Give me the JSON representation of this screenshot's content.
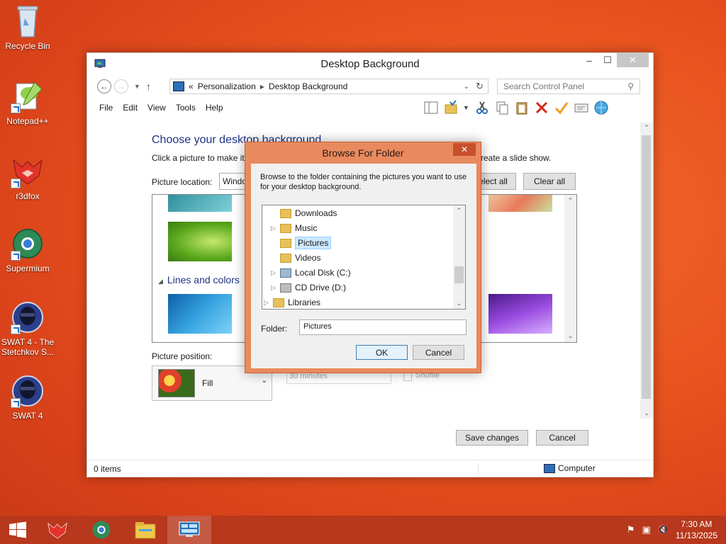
{
  "desktop": {
    "icons": [
      {
        "label": "Recycle Bin"
      },
      {
        "label": "Notepad++"
      },
      {
        "label": "r3dfox"
      },
      {
        "label": "Supermium"
      },
      {
        "label": "SWAT 4 - The Stetchkov S..."
      },
      {
        "label": "SWAT 4"
      }
    ]
  },
  "window": {
    "title": "Desktop Background",
    "breadcrumb": [
      "«",
      "Personalization",
      "Desktop Background"
    ],
    "search_placeholder": "Search Control Panel",
    "menu": [
      "File",
      "Edit",
      "View",
      "Tools",
      "Help"
    ],
    "heading": "Choose your desktop background",
    "subtext": "Click a picture to make it",
    "subtext_tail": "reate a slide show.",
    "picture_location_label": "Picture location:",
    "picture_location_value": "Windo",
    "select_all": "elect all",
    "clear_all": "Clear all",
    "group_label": "Lines and colors",
    "picture_position_label": "Picture position:",
    "picture_position_value": "Fill",
    "interval_value": "30 minutes",
    "shuffle_label": "Shuffle",
    "save_changes": "Save changes",
    "cancel": "Cancel",
    "status_items": "0 items",
    "status_location": "Computer"
  },
  "dialog": {
    "title": "Browse For Folder",
    "description": "Browse to the folder containing the pictures you want to use for your desktop background.",
    "tree": [
      {
        "label": "Downloads",
        "expandable": false,
        "selected": false,
        "icon": "download-folder-icon"
      },
      {
        "label": "Music",
        "expandable": true,
        "selected": false,
        "icon": "music-folder-icon"
      },
      {
        "label": "Pictures",
        "expandable": false,
        "selected": true,
        "icon": "pictures-folder-icon"
      },
      {
        "label": "Videos",
        "expandable": false,
        "selected": false,
        "icon": "videos-folder-icon"
      },
      {
        "label": "Local Disk (C:)",
        "expandable": true,
        "selected": false,
        "icon": "local-disk-icon"
      },
      {
        "label": "CD Drive (D:)",
        "expandable": true,
        "selected": false,
        "icon": "cd-drive-icon"
      },
      {
        "label": "Libraries",
        "expandable": true,
        "selected": false,
        "icon": "libraries-icon"
      }
    ],
    "folder_label": "Folder:",
    "folder_value": "Pictures",
    "ok": "OK",
    "cancel": "Cancel"
  },
  "taskbar": {
    "time": "7:30 AM",
    "date": "11/13/2025"
  },
  "colors": {
    "accent": "#1e3287",
    "dialog_frame": "#e98a5e",
    "taskbar": "#b7381c",
    "selection": "#cce8ff"
  }
}
